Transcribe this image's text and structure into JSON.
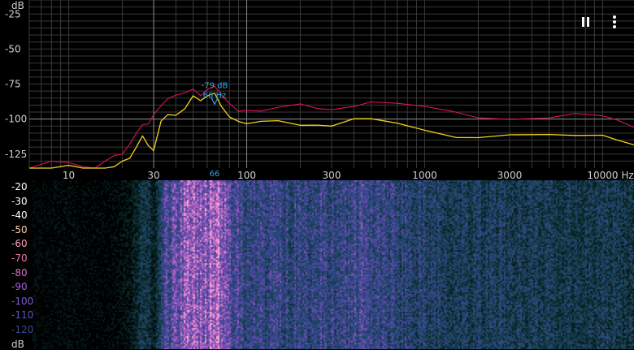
{
  "spectrum": {
    "y_unit": "dB",
    "y_ticks": [
      "-25",
      "-50",
      "-75",
      "-100",
      "-125"
    ],
    "x_ticks": [
      "10",
      "30",
      "100",
      "300",
      "1000",
      "3000",
      "10000"
    ],
    "x_unit": "Hz",
    "peak": {
      "db_label": "-79 dB",
      "hz_label": "66 Hz",
      "axis_marker": "66",
      "hz": 66,
      "db": -79
    },
    "colors": {
      "grid": "#3a3a3a",
      "grid_major": "#8a8a8a",
      "peak_hold": "#d6174a",
      "live": "#f2d21a",
      "marker": "#32a4e6",
      "label": "#cfcfcf"
    }
  },
  "spectrogram": {
    "db_labels": [
      "-20",
      "-30",
      "-40",
      "-50",
      "-60",
      "-70",
      "-80",
      "-90",
      "-100",
      "-110",
      "-120",
      "dB"
    ],
    "label_colors": [
      "#ffffff",
      "#ffffff",
      "#ffffff",
      "#ffd0a8",
      "#ff9fc0",
      "#f07ab8",
      "#d870c8",
      "#a060d8",
      "#7c5cd8",
      "#5a54c0",
      "#3c4a9a",
      "#cfcfcf"
    ]
  },
  "toolbar": {
    "pause_icon": "pause-icon",
    "menu_icon": "more-vertical-icon"
  },
  "chart_data": {
    "type": "line",
    "xscale": "log",
    "xlim": [
      6,
      15000
    ],
    "ylim": [
      -135,
      -15
    ],
    "xlabel": "Hz",
    "ylabel": "dB",
    "series": [
      {
        "x": [
          6,
          8,
          10,
          12,
          14,
          16,
          18,
          20,
          22,
          24,
          26,
          28,
          30,
          33,
          36,
          40,
          45,
          50,
          55,
          60,
          66,
          72,
          80,
          90,
          100,
          120,
          150,
          200,
          250,
          300,
          400,
          500,
          700,
          1000,
          1500,
          2000,
          3000,
          5000,
          7000,
          10000,
          12000,
          15000
        ],
        "y": [
          -135,
          -130,
          -131,
          -134,
          -135,
          -130,
          -126,
          -125,
          -118,
          -110,
          -104,
          -101,
          -96,
          -92,
          -88,
          -84,
          -80,
          -76,
          -82,
          -80,
          -79,
          -84,
          -88,
          -92,
          -92,
          -95,
          -94,
          -91,
          -92,
          -91,
          -89,
          -88,
          -91,
          -93,
          -95,
          -97,
          -98,
          -99,
          -98,
          -100,
          -101,
          -104
        ]
      },
      {
        "x": [
          6,
          8,
          10,
          12,
          14,
          16,
          18,
          20,
          22,
          24,
          26,
          28,
          30,
          33,
          36,
          40,
          45,
          50,
          55,
          60,
          66,
          72,
          80,
          90,
          100,
          120,
          150,
          200,
          250,
          300,
          400,
          500,
          700,
          1000,
          1500,
          2000,
          3000,
          5000,
          7000,
          10000,
          12000,
          15000
        ],
        "y": [
          -135,
          -135,
          -133,
          -135,
          -135,
          -135,
          -134,
          -130,
          -128,
          -120,
          -112,
          -118,
          -124,
          -104,
          -98,
          -96,
          -90,
          -82,
          -88,
          -86,
          -83,
          -90,
          -96,
          -100,
          -104,
          -104,
          -103,
          -104,
          -102,
          -103,
          -100,
          -102,
          -105,
          -108,
          -111,
          -111,
          -111,
          -113,
          -114,
          -112,
          -113,
          -116
        ]
      }
    ]
  }
}
